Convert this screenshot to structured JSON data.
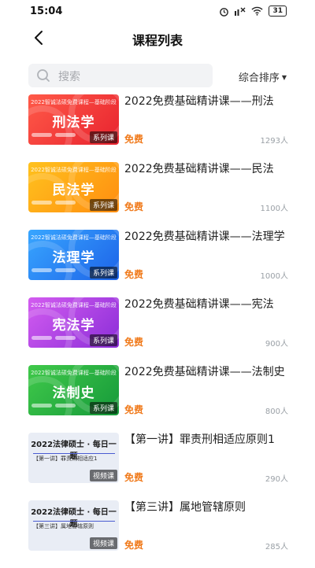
{
  "status": {
    "time": "15:04",
    "battery": "31"
  },
  "header": {
    "title": "课程列表"
  },
  "search": {
    "placeholder": "搜索"
  },
  "sort": {
    "label": "综合排序"
  },
  "colors": {
    "accent": "#f07a1b"
  },
  "courses": [
    {
      "thumb_top": "2022智诚法硕免费课程—基础阶段",
      "thumb_title": "刑法学",
      "badge": "系列课",
      "name": "2022免费基础精讲课——刑法",
      "price": "免费",
      "count": "1293人",
      "theme": "red"
    },
    {
      "thumb_top": "2022智诚法硕免费课程—基础阶段",
      "thumb_title": "民法学",
      "badge": "系列课",
      "name": "2022免费基础精讲课——民法",
      "price": "免费",
      "count": "1100人",
      "theme": "orange"
    },
    {
      "thumb_top": "2022智诚法硕免费课程—基础阶段",
      "thumb_title": "法理学",
      "badge": "系列课",
      "name": "2022免费基础精讲课——法理学",
      "price": "免费",
      "count": "1000人",
      "theme": "blue"
    },
    {
      "thumb_top": "2022智诚法硕免费课程—基础阶段",
      "thumb_title": "宪法学",
      "badge": "系列课",
      "name": "2022免费基础精讲课——宪法",
      "price": "免费",
      "count": "900人",
      "theme": "purple"
    },
    {
      "thumb_top": "2022智诚法硕免费课程—基础阶段",
      "thumb_title": "法制史",
      "badge": "系列课",
      "name": "2022免费基础精讲课——法制史",
      "price": "免费",
      "count": "800人",
      "theme": "green"
    },
    {
      "thumb_top": "2022法律硕士 · 每日一题",
      "thumb_title": "【第一讲】罪责刑相适应1",
      "badge": "视频课",
      "name": "【第一讲】罪责刑相适应原则1",
      "price": "免费",
      "count": "290人",
      "theme": "light"
    },
    {
      "thumb_top": "2022法律硕士 · 每日一题",
      "thumb_title": "【第三讲】属地管辖原则",
      "badge": "视频课",
      "name": "【第三讲】属地管辖原则",
      "price": "免费",
      "count": "285人",
      "theme": "light"
    }
  ]
}
